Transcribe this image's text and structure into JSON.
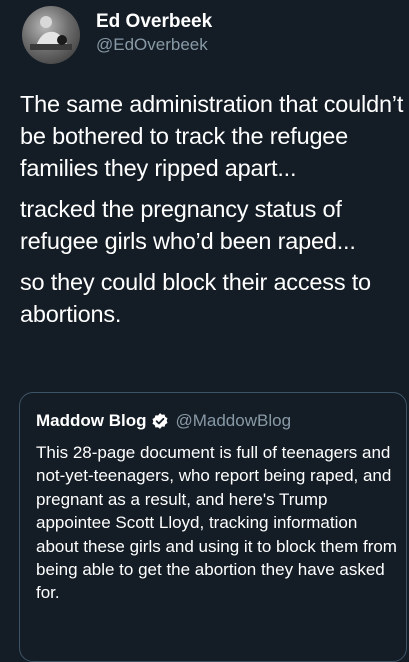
{
  "author": {
    "display_name": "Ed Overbeek",
    "handle": "@EdOverbeek",
    "avatar_icon": "profile-photo-avatar"
  },
  "tweet": {
    "paragraphs": [
      "The same administration that couldn’t be bothered to track the refugee families they ripped apart...",
      "tracked the pregnancy status of refugee girls who’d been raped...",
      "so they could block their access to abortions."
    ]
  },
  "quoted_tweet": {
    "display_name": "Maddow Blog",
    "verified_icon": "verified-badge-icon",
    "handle": "@MaddowBlog",
    "text": "This 28-page document is full of teenagers and not-yet-teenagers, who report being raped, and pregnant as a result, and here's Trump appointee Scott Lloyd, tracking information about these girls and using it to block them from being able to get the abortion they have asked for."
  },
  "colors": {
    "background": "#141d26",
    "text": "#ffffff",
    "secondary_text": "#8899a6",
    "border": "#3d5466",
    "verified": "#ffffff"
  }
}
